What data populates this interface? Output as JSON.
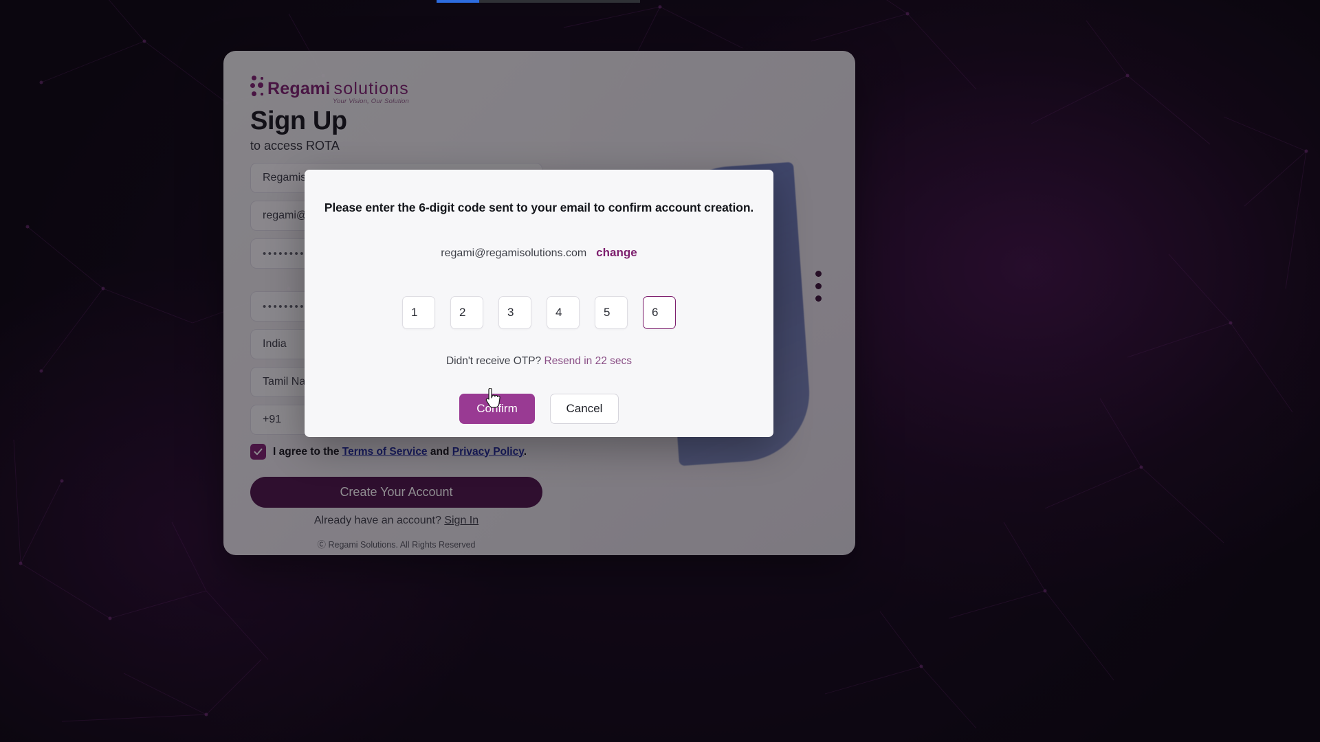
{
  "brand": {
    "name_bold": "Regami",
    "name_light": "solutions",
    "tagline": "Your Vision, Our Solution",
    "accent_purple": "#7d1f6e",
    "deep_purple": "#4d1448",
    "modal_purple": "#993a93"
  },
  "signup": {
    "title": "Sign Up",
    "subtitle": "to access ROTA",
    "fields": [
      {
        "name": "company",
        "value": "Regamisolutions"
      },
      {
        "name": "email",
        "value": "regami@regamisolutions.com"
      },
      {
        "name": "password",
        "value": "••••••••"
      },
      {
        "name": "confirm-password",
        "value": "••••••••"
      },
      {
        "name": "country",
        "value": "India"
      },
      {
        "name": "state",
        "value": "Tamil Nadu"
      },
      {
        "name": "country-code",
        "value": "+91"
      },
      {
        "name": "phone",
        "value": ""
      }
    ],
    "terms_prefix": "I agree to the ",
    "terms_link": "Terms of Service",
    "terms_and": " and ",
    "privacy_link": "Privacy Policy",
    "terms_suffix": ".",
    "create_button": "Create Your Account",
    "already_text": "Already have an account?",
    "signin_link": "Sign In",
    "copyright": "Ⓒ Regami Solutions. All Rights Reserved"
  },
  "modal": {
    "heading": "Please enter the 6-digit code sent to your email to confirm account creation.",
    "email": "regami@regamisolutions.com",
    "change_label": "change",
    "otp_digits": [
      "1",
      "2",
      "3",
      "4",
      "5",
      "6"
    ],
    "focused_index": 5,
    "resend_prefix": "Didn't receive OTP?",
    "resend_label": "Resend in 22 secs",
    "confirm_label": "Confirm",
    "cancel_label": "Cancel"
  }
}
